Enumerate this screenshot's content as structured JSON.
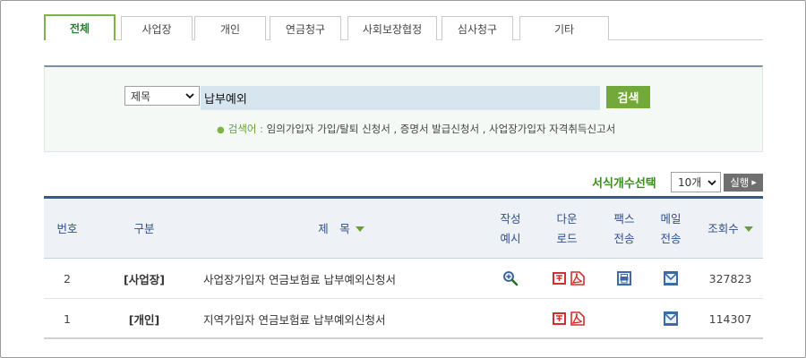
{
  "tabs": [
    {
      "label": "전체",
      "active": true
    },
    {
      "label": "사업장",
      "active": false
    },
    {
      "label": "개인",
      "active": false
    },
    {
      "label": "연금청구",
      "active": false
    },
    {
      "label": "사회보장협정",
      "active": false
    },
    {
      "label": "심사청구",
      "active": false
    },
    {
      "label": "기타",
      "active": false
    }
  ],
  "search": {
    "field_selected": "제목",
    "query": "납부예외",
    "button_label": "검색",
    "hint_label": "검색어 :",
    "hint_text": " 임의가입자 가입/탈퇴 신청서 , 증명서 발급신청서 , 사업장가입자 자격취득신고서"
  },
  "page_size": {
    "label": "서식개수선택",
    "selected": "10개",
    "run_label": "실행"
  },
  "table": {
    "headers": {
      "no": "번호",
      "category": "구분",
      "title": "제　목",
      "example": [
        "작성",
        "예시"
      ],
      "download": [
        "다운",
        "로드"
      ],
      "fax": [
        "팩스",
        "전송"
      ],
      "mail": [
        "메일",
        "전송"
      ],
      "views": "조회수"
    },
    "rows": [
      {
        "no": "2",
        "category": "[사업장]",
        "title": "사업장가입자 연금보험료 납부예외신청서",
        "has_example": true,
        "views": "327823"
      },
      {
        "no": "1",
        "category": "[개인]",
        "title": "지역가입자 연금보험료 납부예외신청서",
        "has_example": false,
        "views": "114307"
      }
    ]
  },
  "colors": {
    "accent_green": "#73a83b",
    "header_blue": "#37588c",
    "download_red": "#d32f2f",
    "action_blue": "#3f6aa8"
  }
}
